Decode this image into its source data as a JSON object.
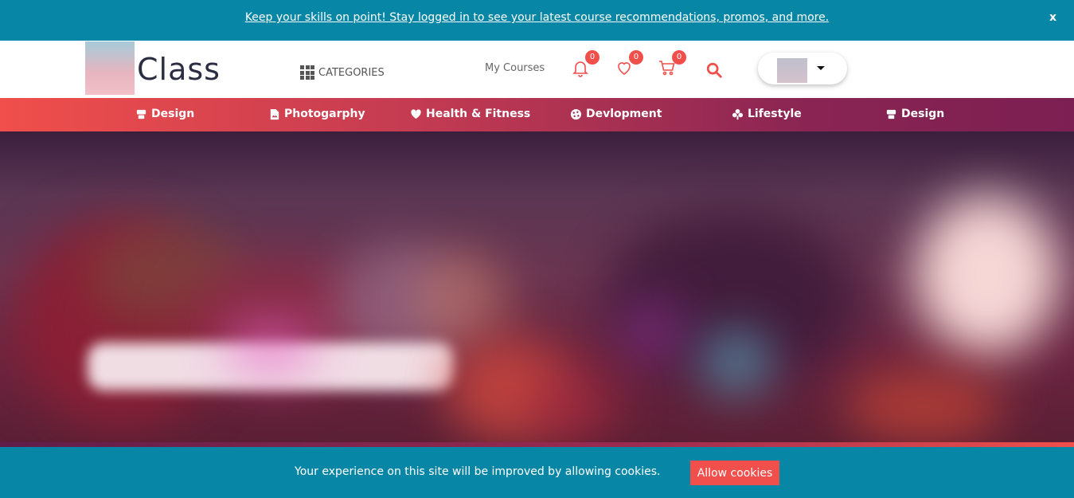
{
  "banner": {
    "message": "Keep your skills on point! Stay logged in to see your latest course recommendations, promos, and more.",
    "close_label": "x"
  },
  "header": {
    "logo_text": "Class",
    "categories_label": "CATEGORIES",
    "my_courses_label": "My Courses",
    "notifications_count": "0",
    "wishlist_count": "0",
    "cart_count": "0"
  },
  "category_nav": {
    "items": [
      {
        "label": "Design",
        "icon": "design-icon"
      },
      {
        "label": "Photogarphy",
        "icon": "photo-icon"
      },
      {
        "label": "Health & Fitness",
        "icon": "heart-icon"
      },
      {
        "label": "Devlopment",
        "icon": "development-icon"
      },
      {
        "label": "Lifestyle",
        "icon": "lifestyle-icon"
      },
      {
        "label": "Design",
        "icon": "design-icon"
      }
    ]
  },
  "cookie": {
    "message": "Your experience on this site will be improved by allowing cookies.",
    "button_label": "Allow cookies"
  },
  "colors": {
    "brand_teal": "#0886a6",
    "accent_red": "#f04f4b",
    "nav_gradient_end": "#7c1f52"
  }
}
